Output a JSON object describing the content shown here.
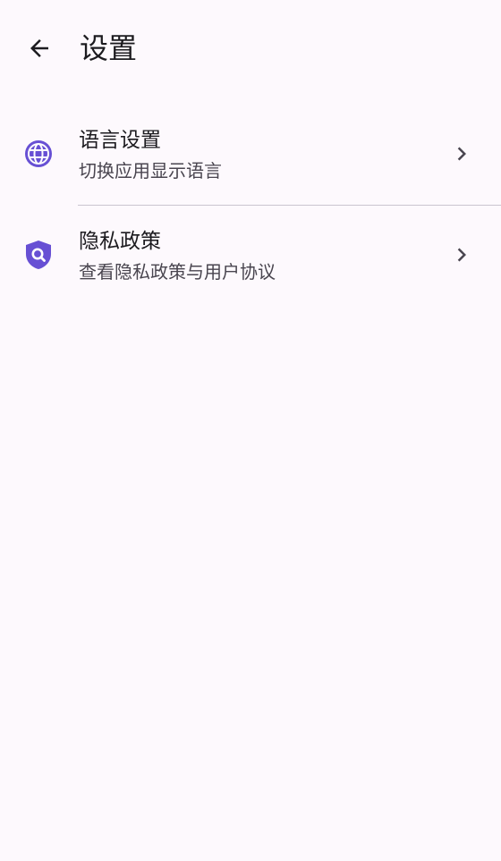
{
  "header": {
    "title": "设置",
    "back_icon": "arrow-back-icon"
  },
  "settings": [
    {
      "icon": "globe-icon",
      "icon_color": "#6750d4",
      "title": "语言设置",
      "subtitle": "切换应用显示语言"
    },
    {
      "icon": "privacy-shield-icon",
      "icon_color": "#6750d4",
      "title": "隐私政策",
      "subtitle": "查看隐私政策与用户协议"
    }
  ],
  "colors": {
    "background": "#fdf9fd",
    "accent": "#6750d4",
    "text_primary": "#1c1b1f",
    "text_secondary": "#49454f",
    "divider": "#cac4cf"
  }
}
